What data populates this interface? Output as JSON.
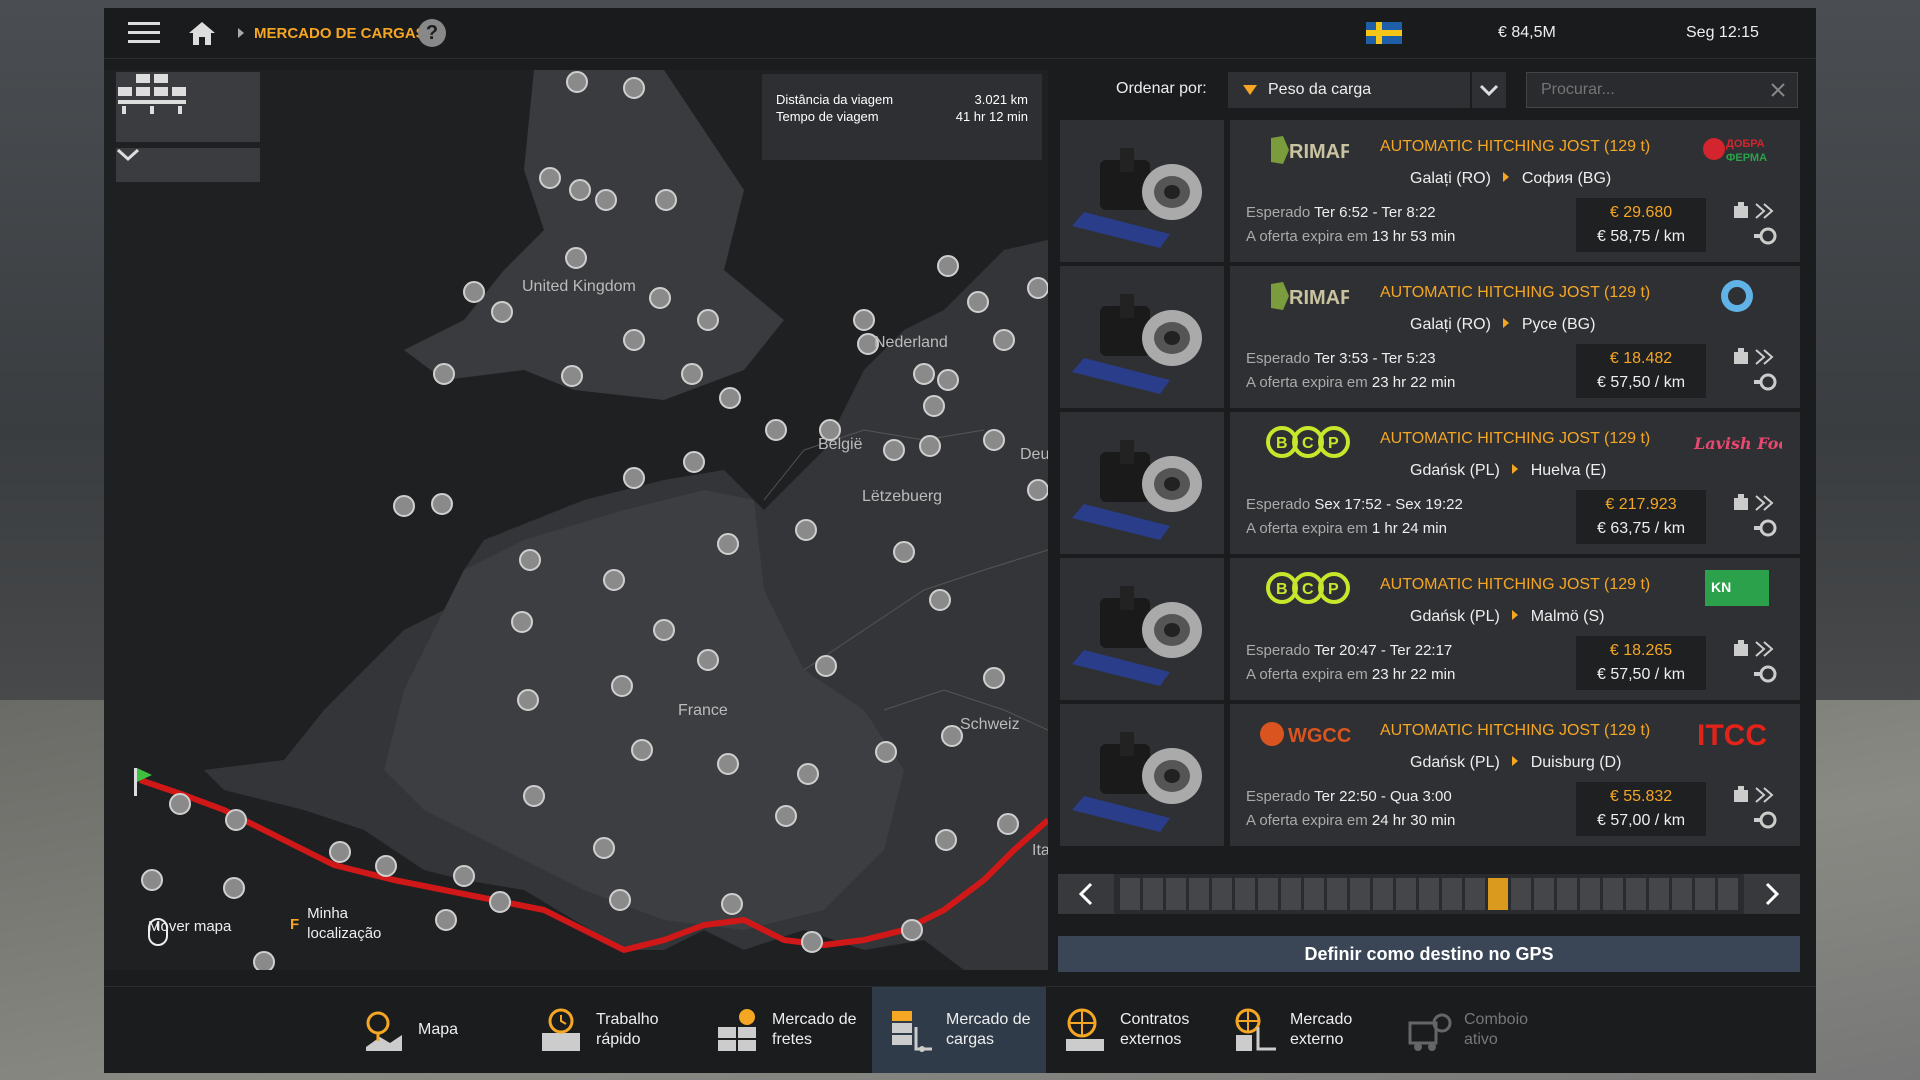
{
  "topbar": {
    "breadcrumb": "MERCADO DE CARGAS",
    "help": "?",
    "money": "€ 84,5M",
    "clock": "Seg 12:15"
  },
  "map": {
    "tooltip": {
      "distance_label": "Distância da viagem",
      "distance_value": "3.021 km",
      "time_label": "Tempo de viagem",
      "time_value": "41 hr 12 min"
    },
    "labels": {
      "uk": "United Kingdom",
      "nl": "Nederland",
      "be": "België",
      "lu": "Lëtzebuerg",
      "fr": "France",
      "ch": "Schweiz",
      "de": "Deu",
      "it": "Ita"
    },
    "footer": {
      "move_label": "Mover mapa",
      "loc_key": "F",
      "loc_label": "Minha localização"
    }
  },
  "sort": {
    "label": "Ordenar por:",
    "value": "Peso da carga"
  },
  "search": {
    "placeholder": "Procurar..."
  },
  "offers": [
    {
      "company": "RIMAF",
      "cargo": "AUTOMATIC HITCHING JOST (129 t)",
      "from": "Galați (RO)",
      "to": "София (BG)",
      "exp_label": "Esperado",
      "expected": "Ter 6:52 - Ter 8:22",
      "expires_label": "A oferta expira em",
      "expires": "13 hr 53 min",
      "price": "€ 29.680",
      "per_km": "€ 58,75 / km",
      "client": "Добра Ферма"
    },
    {
      "company": "RIMAF",
      "cargo": "AUTOMATIC HITCHING JOST (129 t)",
      "from": "Galați (RO)",
      "to": "Русе (BG)",
      "exp_label": "Esperado",
      "expected": "Ter 3:53 - Ter 5:23",
      "expires_label": "A oferta expira em",
      "expires": "23 hr 22 min",
      "price": "€ 18.482",
      "per_km": "€ 57,50 / km",
      "client": ""
    },
    {
      "company": "BCP",
      "cargo": "AUTOMATIC HITCHING JOST (129 t)",
      "from": "Gdańsk (PL)",
      "to": "Huelva (E)",
      "exp_label": "Esperado",
      "expected": "Sex 17:52 - Sex 19:22",
      "expires_label": "A oferta expira em",
      "expires": "1 hr 24 min",
      "price": "€ 217.923",
      "per_km": "€ 63,75 / km",
      "client": "Lavish Foods"
    },
    {
      "company": "BCP",
      "cargo": "AUTOMATIC HITCHING JOST (129 t)",
      "from": "Gdańsk (PL)",
      "to": "Malmö (S)",
      "exp_label": "Esperado",
      "expected": "Ter 20:47 - Ter 22:17",
      "expires_label": "A oferta expira em",
      "expires": "23 hr 22 min",
      "price": "€ 18.265",
      "per_km": "€ 57,50 / km",
      "client": "KONSTNORR"
    },
    {
      "company": "WGCC",
      "cargo": "AUTOMATIC HITCHING JOST (129 t)",
      "from": "Gdańsk (PL)",
      "to": "Duisburg (D)",
      "exp_label": "Esperado",
      "expected": "Ter 22:50 - Qua 3:00",
      "expires_label": "A oferta expira em",
      "expires": "24 hr 30 min",
      "price": "€ 55.832",
      "per_km": "€ 57,00 / km",
      "client": "ITCC"
    }
  ],
  "pager": {
    "total_pages": 27,
    "current_page": 17
  },
  "gps_button": "Definir como destino no GPS",
  "bottom_tabs": [
    {
      "label1": "Mapa",
      "label2": "",
      "icon": "map-pin-icon"
    },
    {
      "label1": "Trabalho",
      "label2": "rápido",
      "icon": "quick-job-icon"
    },
    {
      "label1": "Mercado de",
      "label2": "fretes",
      "icon": "freight-market-icon"
    },
    {
      "label1": "Mercado de",
      "label2": "cargas",
      "icon": "cargo-market-icon"
    },
    {
      "label1": "Contratos",
      "label2": "externos",
      "icon": "globe-contracts-icon"
    },
    {
      "label1": "Mercado",
      "label2": "externo",
      "icon": "external-market-icon"
    },
    {
      "label1": "Comboio",
      "label2": "ativo",
      "icon": "convoy-icon"
    }
  ],
  "colors": {
    "accent": "#f5a623",
    "route": "#d01818",
    "active_tab": "#2f3b48"
  }
}
